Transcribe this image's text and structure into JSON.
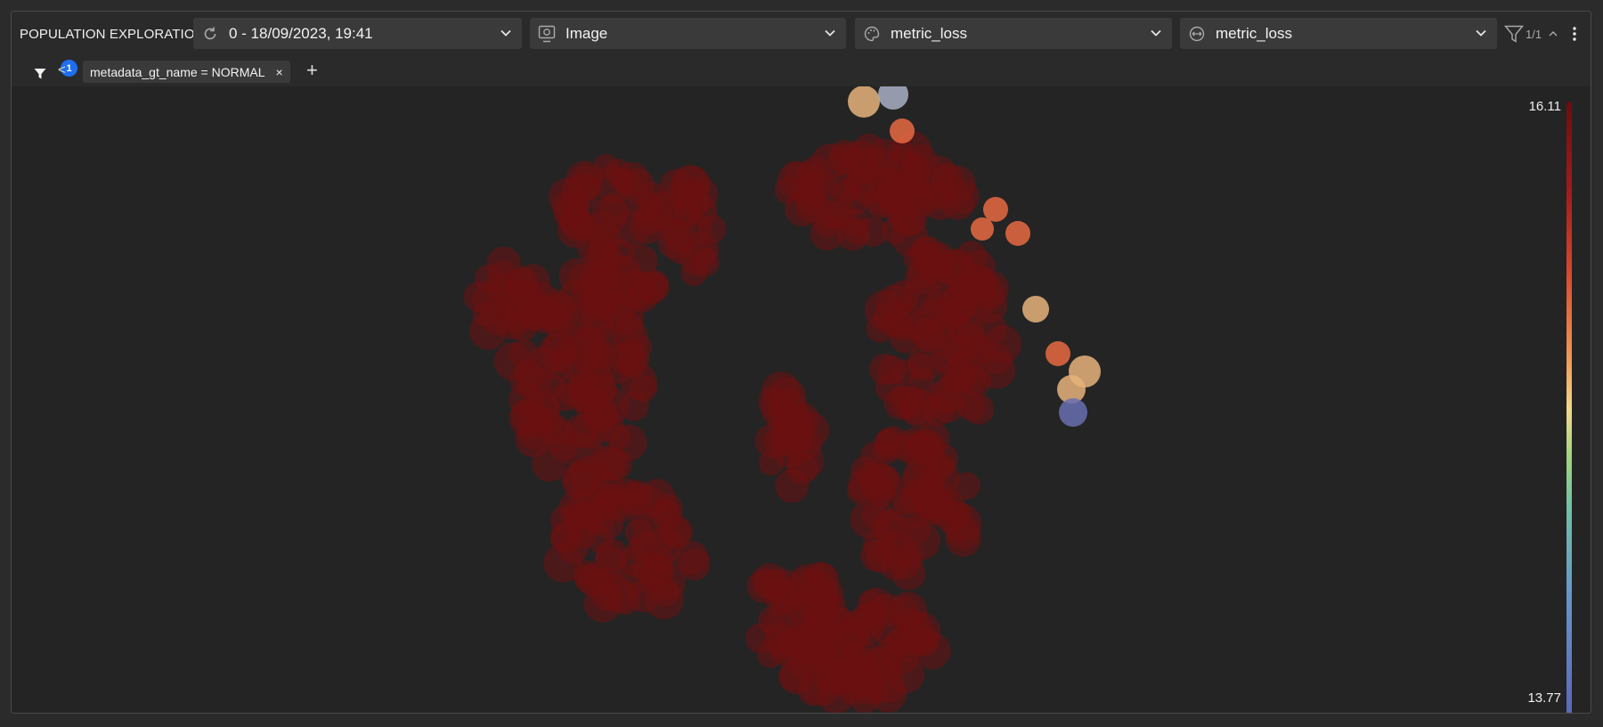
{
  "toolbar": {
    "title": "POPULATION EXPLORATION",
    "version_select": {
      "value": "0 - 18/09/2023, 19:41",
      "icon": "refresh-icon"
    },
    "vis_type_select": {
      "value": "Image",
      "icon": "image-icon"
    },
    "color_select": {
      "value": "metric_loss",
      "icon": "palette-icon"
    },
    "size_select": {
      "value": "metric_loss",
      "icon": "size-icon"
    },
    "filter_count": "1/1"
  },
  "filters": {
    "badge_count": "1",
    "collapse_label": "<",
    "chips": [
      {
        "label": "metadata_gt_name = NORMAL",
        "remove_label": "×"
      }
    ],
    "add_label": "+"
  },
  "colorbar": {
    "max_label": "16.11",
    "min_label": "13.77",
    "colors": [
      "#6e0c0c",
      "#d94a2b",
      "#f2d98a",
      "#6ec2a5",
      "#5a67b8"
    ]
  },
  "colors": {
    "point_default": "#6b1010",
    "point_hot": "#e86a42",
    "point_warm": "#e6b37a",
    "point_cool": "#6a6fb0"
  }
}
